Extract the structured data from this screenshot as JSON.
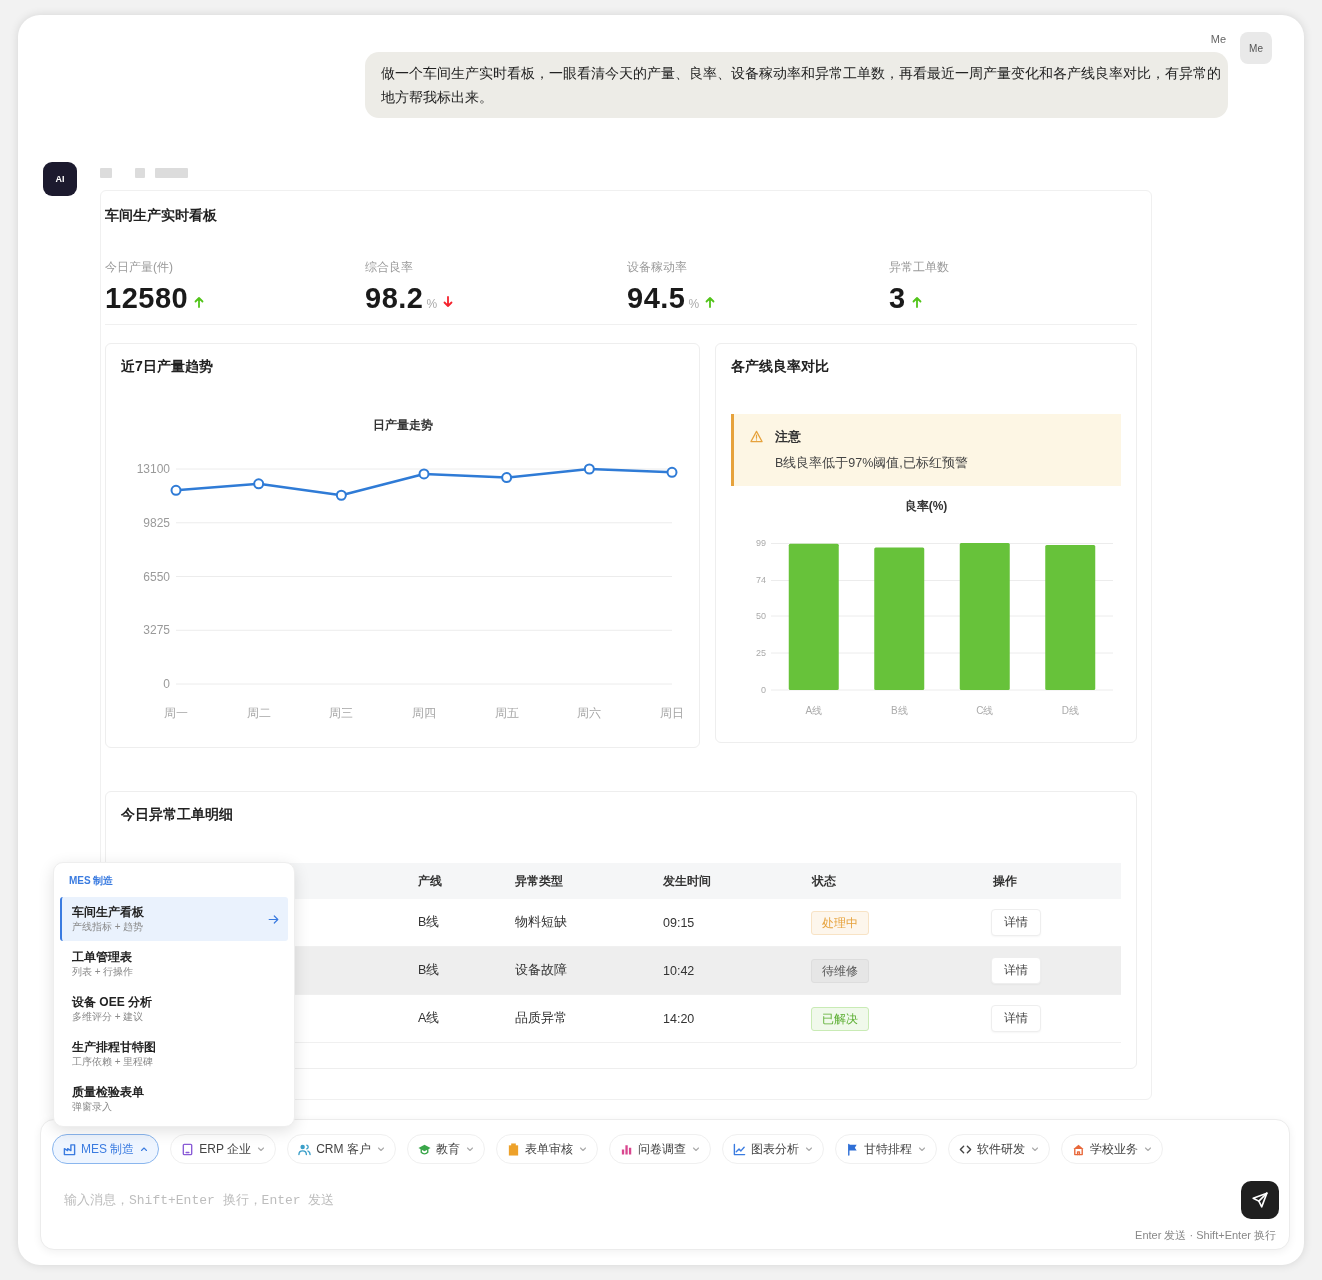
{
  "user_message": {
    "sender": "Me",
    "avatar": "Me",
    "text": "做一个车间生产实时看板，一眼看清今天的产量、良率、设备稼动率和异常工单数，再看最近一周产量变化和各产线良率对比，有异常的地方帮我标出来。"
  },
  "assistant": {
    "avatar": "AI"
  },
  "dashboard": {
    "title": "车间生产实时看板",
    "kpis": [
      {
        "label": "今日产量(件)",
        "value": "12580",
        "rising": true
      },
      {
        "label": "综合良率",
        "value": "98.2",
        "unit": "%",
        "rising": false
      },
      {
        "label": "设备稼动率",
        "value": "94.5",
        "unit": "%",
        "rising": true
      },
      {
        "label": "异常工单数",
        "value": "3",
        "rising": true
      }
    ],
    "trend_card": {
      "title": "近7日产量趋势",
      "chart_data": {
        "type": "line",
        "title": "日产量走势",
        "categories": [
          "周一",
          "周二",
          "周三",
          "周四",
          "周五",
          "周六",
          "周日"
        ],
        "series": [
          {
            "color": "#2f7bd6",
            "marker": "circle",
            "values": [
              11800,
              12200,
              11500,
              12800,
              12580,
              13100,
              12900
            ]
          }
        ],
        "ylim": [
          0,
          13100
        ],
        "yticks": [
          0,
          3275,
          6550,
          9825,
          13100
        ],
        "grid": true
      }
    },
    "yield_card": {
      "title": "各产线良率对比",
      "alert": {
        "kind": "warning",
        "title": "注意",
        "text": "B线良率低于97%阈值,已标红预警"
      },
      "chart_data": {
        "type": "bar",
        "title": "良率(%)",
        "categories": [
          "A线",
          "B线",
          "C线",
          "D线"
        ],
        "series": [
          {
            "color": "#67c23a",
            "values": [
              98.8,
              96.2,
              99.3,
              97.9
            ]
          }
        ],
        "ylim": [
          0,
          100
        ],
        "yticks": [
          0,
          25,
          50,
          74,
          99
        ],
        "grid": true
      }
    },
    "issues_table": {
      "title": "今日异常工单明细",
      "columns": [
        "产线",
        "异常类型",
        "发生时间",
        "状态",
        "操作"
      ],
      "rows": [
        {
          "line": "B线",
          "issue_type": "物料短缺",
          "time": "09:15",
          "status": {
            "text": "处理中",
            "kind": "warning"
          },
          "action": "详情",
          "highlighted": false
        },
        {
          "line": "B线",
          "issue_type": "设备故障",
          "time": "10:42",
          "status": {
            "text": "待维修",
            "kind": "info"
          },
          "action": "详情",
          "highlighted": true
        },
        {
          "line": "A线",
          "issue_type": "品质异常",
          "time": "14:20",
          "status": {
            "text": "已解决",
            "kind": "success"
          },
          "action": "详情",
          "highlighted": false
        }
      ]
    }
  },
  "chip_menu": {
    "heading": "MES 制造",
    "items": [
      {
        "title": "车间生产看板",
        "subtitle": "产线指标 + 趋势",
        "selected": true
      },
      {
        "title": "工单管理表",
        "subtitle": "列表 + 行操作",
        "selected": false
      },
      {
        "title": "设备 OEE 分析",
        "subtitle": "多维评分 + 建议",
        "selected": false
      },
      {
        "title": "生产排程甘特图",
        "subtitle": "工序依赖 + 里程碑",
        "selected": false
      },
      {
        "title": "质量检验表单",
        "subtitle": "弹窗录入",
        "selected": false
      }
    ]
  },
  "composer": {
    "chips": [
      {
        "label": "MES 制造",
        "selected": true,
        "color": "#3a7be0"
      },
      {
        "label": "ERP 企业",
        "selected": false,
        "color": "#8a5cd6"
      },
      {
        "label": "CRM 客户",
        "selected": false,
        "color": "#3b9fc9"
      },
      {
        "label": "教育",
        "selected": false,
        "color": "#3aa64a"
      },
      {
        "label": "表单审核",
        "selected": false,
        "color": "#eda12a"
      },
      {
        "label": "问卷调查",
        "selected": false,
        "color": "#d9468f"
      },
      {
        "label": "图表分析",
        "selected": false,
        "color": "#3a7be0"
      },
      {
        "label": "甘特排程",
        "selected": false,
        "color": "#2f6fd6"
      },
      {
        "label": "软件研发",
        "selected": false,
        "color": "#444444"
      },
      {
        "label": "学校业务",
        "selected": false,
        "color": "#e8683a"
      }
    ],
    "placeholder": "输入消息，Shift+Enter 换行，Enter 发送",
    "hint": "Enter 发送 · Shift+Enter 换行"
  }
}
